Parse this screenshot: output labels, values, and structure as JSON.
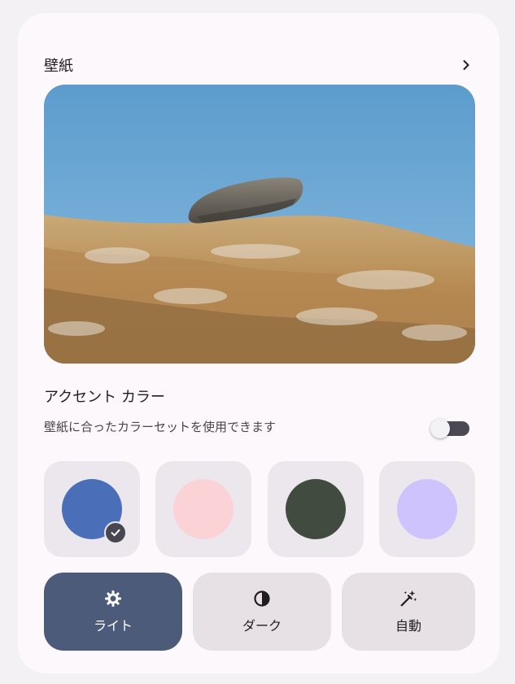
{
  "wallpaper": {
    "title": "壁紙",
    "chevron_icon": "chevron-right-icon"
  },
  "accent": {
    "title": "アクセント カラー",
    "subtitle": "壁紙に合ったカラーセットを使用できます",
    "toggle_on": false
  },
  "swatches": [
    {
      "color": "#4a6fb8",
      "selected": true
    },
    {
      "color": "#fbd3d6",
      "selected": false
    },
    {
      "color": "#414b3f",
      "selected": false
    },
    {
      "color": "#cfc3fd",
      "selected": false
    }
  ],
  "modes": [
    {
      "label": "ライト",
      "icon": "light-mode-gear-icon",
      "active": true
    },
    {
      "label": "ダーク",
      "icon": "dark-mode-contrast-icon",
      "active": false
    },
    {
      "label": "自動",
      "icon": "auto-magic-wand-icon",
      "active": false
    }
  ],
  "colors": {
    "card_bg": "#fdf8fb",
    "tile_bg": "#ece7ec",
    "active_mode": "#4d5b7a"
  }
}
